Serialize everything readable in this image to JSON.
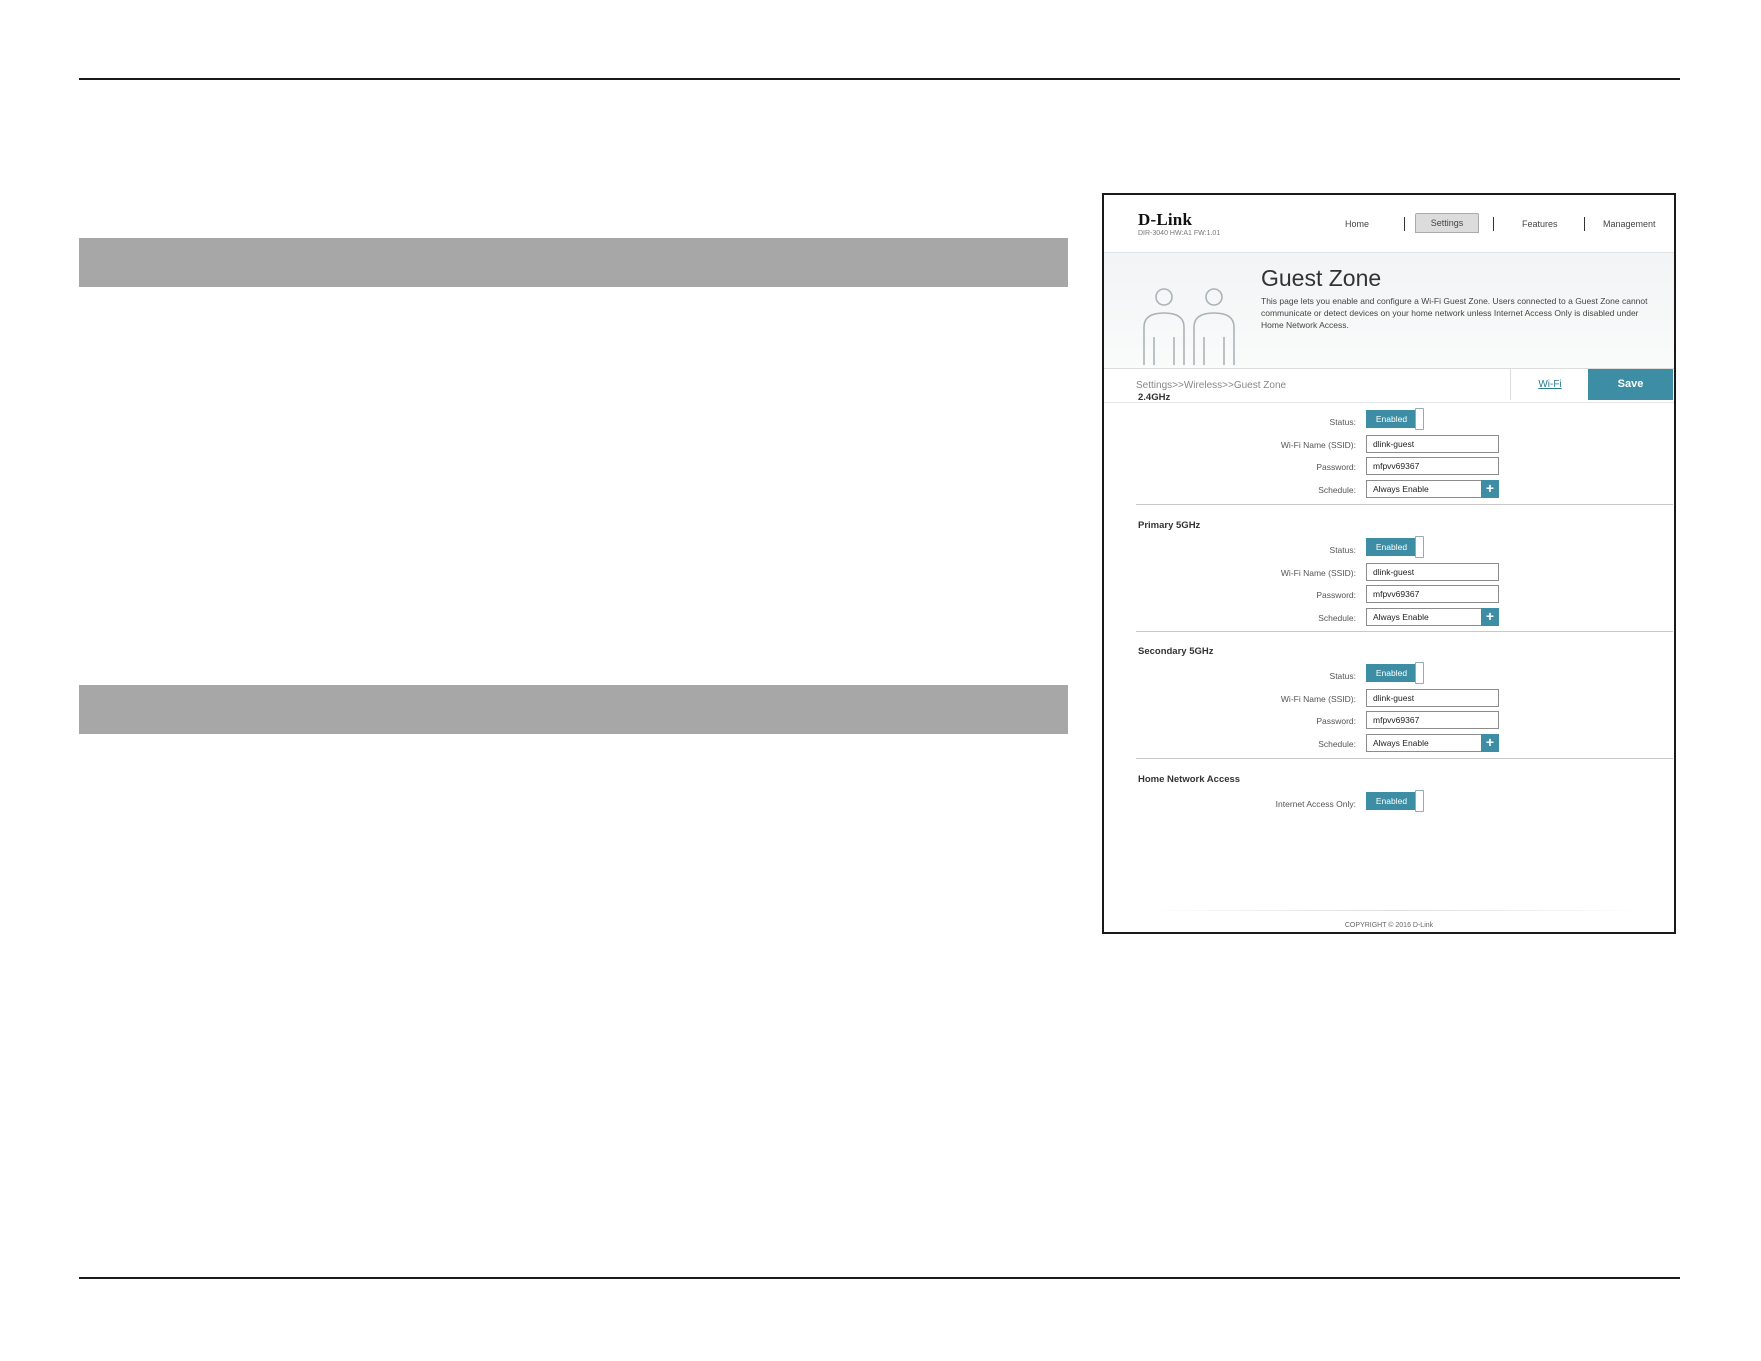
{
  "device": {
    "logo": "D-Link",
    "model": "DIR-3040 HW:A1 FW:1.01"
  },
  "nav": {
    "home": "Home",
    "settings": "Settings",
    "features": "Features",
    "management": "Management"
  },
  "banner": {
    "title": "Guest Zone",
    "description": "This page lets you enable and configure a Wi-Fi Guest Zone. Users connected to a Guest Zone cannot communicate or detect devices on your home network unless Internet Access Only is disabled under Home Network Access."
  },
  "breadcrumb": "Settings>>Wireless>>Guest Zone",
  "actions": {
    "wifi_link": "Wi-Fi",
    "save": "Save"
  },
  "labels": {
    "status": "Status:",
    "ssid": "Wi-Fi Name (SSID):",
    "password": "Password:",
    "schedule": "Schedule:",
    "internet_access_only": "Internet Access Only:"
  },
  "bands": [
    {
      "title": "2.4GHz",
      "status": "Enabled",
      "ssid": "dlink-guest",
      "password": "mfpvv69367",
      "schedule": "Always Enable"
    },
    {
      "title": "Primary 5GHz",
      "status": "Enabled",
      "ssid": "dlink-guest",
      "password": "mfpvv69367",
      "schedule": "Always Enable"
    },
    {
      "title": "Secondary 5GHz",
      "status": "Enabled",
      "ssid": "dlink-guest",
      "password": "mfpvv69367",
      "schedule": "Always Enable"
    }
  ],
  "home_network": {
    "title": "Home Network Access",
    "internet_access_only": "Enabled"
  },
  "footer": {
    "copyright": "COPYRIGHT © 2016 D-Link"
  },
  "colors": {
    "accent": "#3d8ea4",
    "section_bar": "#a7a7a7"
  }
}
